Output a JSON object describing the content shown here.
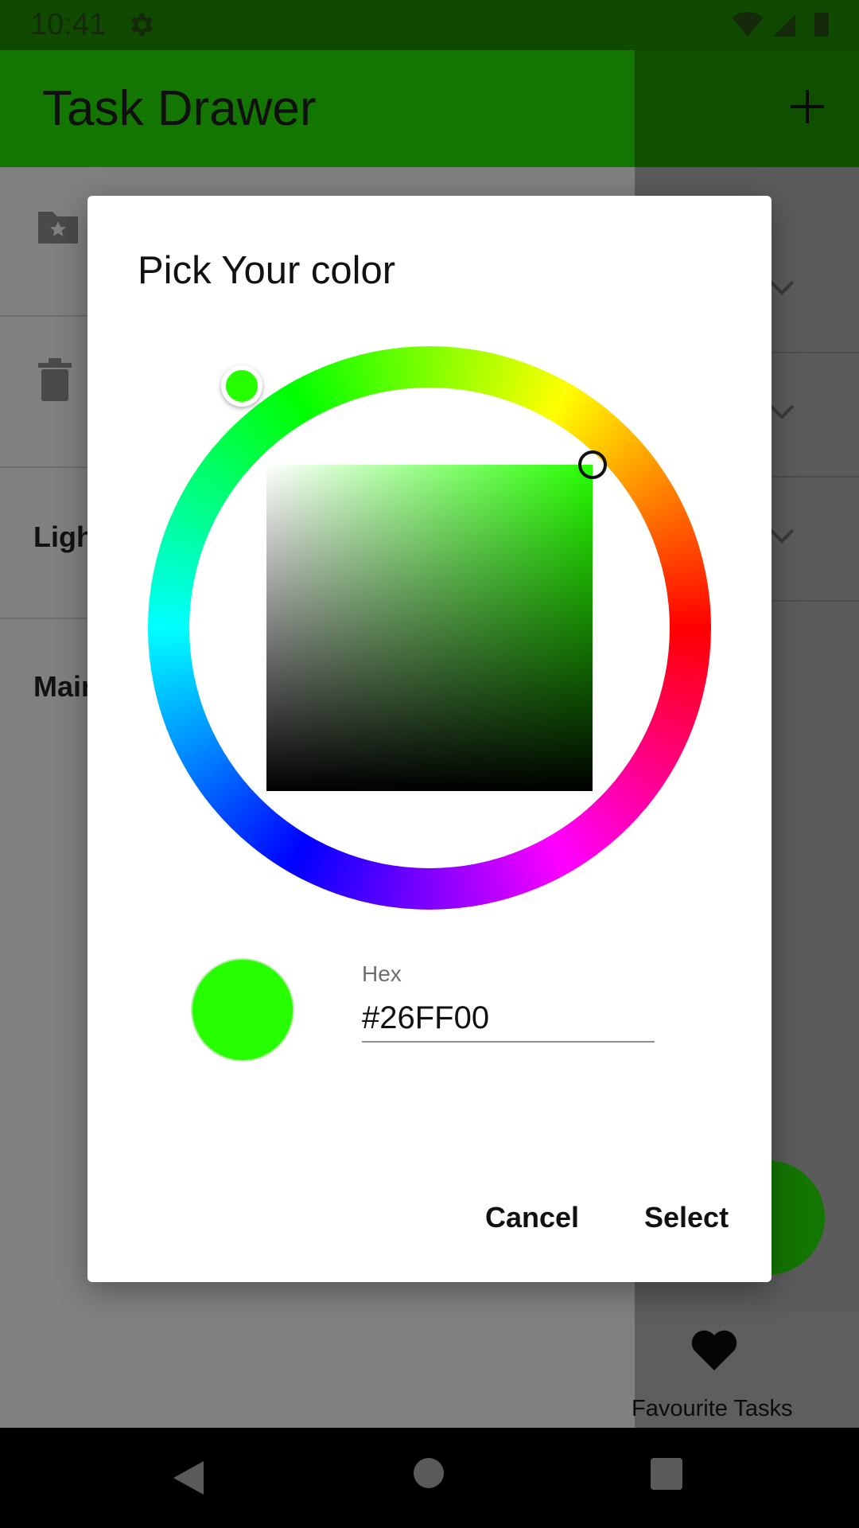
{
  "status_bar": {
    "time": "10:41"
  },
  "app_bar": {
    "title": "Task Drawer"
  },
  "drawer": {
    "items": [
      {
        "label": "",
        "icon": "folder-star-icon"
      },
      {
        "label": "",
        "icon": "trash-icon"
      },
      {
        "label": "Ligh"
      },
      {
        "label": "Mair"
      }
    ]
  },
  "bottom_nav": {
    "favourite_label": "Favourite Tasks"
  },
  "dialog": {
    "title": "Pick Your color",
    "hex_label": "Hex",
    "hex_value": "#26FF00",
    "selected_color": "#26FF00",
    "cancel_label": "Cancel",
    "select_label": "Select"
  },
  "colors": {
    "app_primary": "#137600",
    "selected": "#26FF00"
  }
}
